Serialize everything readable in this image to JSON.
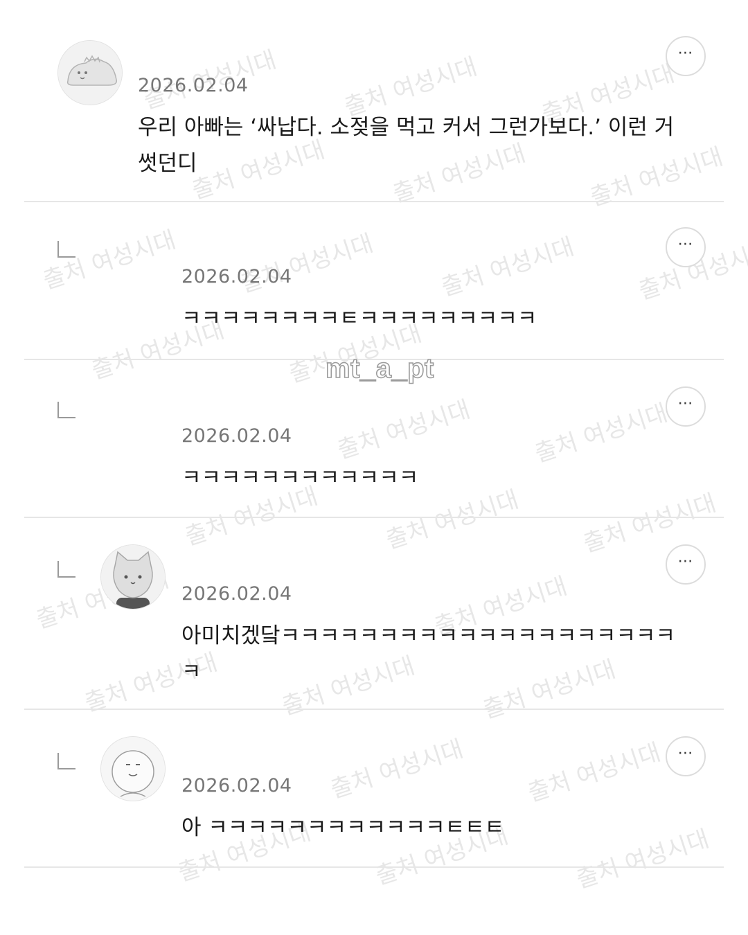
{
  "overlay_handle": "mt_a_pt",
  "watermark_text": "출처 여성시대",
  "comments": [
    {
      "date": "2026.02.04",
      "text": "우리 아빠는 ‘싸납다. 소젖을 먹고 커서 그런가보다.’ 이런 거 썻던디",
      "more_label": "⋯",
      "avatar_icon": "dinosaur-avatar-icon"
    },
    {
      "date": "2026.02.04",
      "text": "ㅋㅋㅋㅋㅋㅋㅋㅋㅌㅋㅋㅋㅋㅋㅋㅋㅋㅋ",
      "more_label": "⋯"
    },
    {
      "date": "2026.02.04",
      "text": "ㅋㅋㅋㅋㅋㅋㅋㅋㅋㅋㅋㅋ",
      "more_label": "⋯"
    },
    {
      "date": "2026.02.04",
      "text": "아미치겠닼ㅋㅋㅋㅋㅋㅋㅋㅋㅋㅋㅋㅋㅋㅋㅋㅋㅋㅋㅋㅋㅋ",
      "more_label": "⋯",
      "avatar_icon": "cat-avatar-icon"
    },
    {
      "date": "2026.02.04",
      "text": "아 ㅋㅋㅋㅋㅋㅋㅋㅋㅋㅋㅋㅋㅌㅌㅌ",
      "more_label": "⋯",
      "avatar_icon": "round-face-avatar-icon"
    }
  ]
}
